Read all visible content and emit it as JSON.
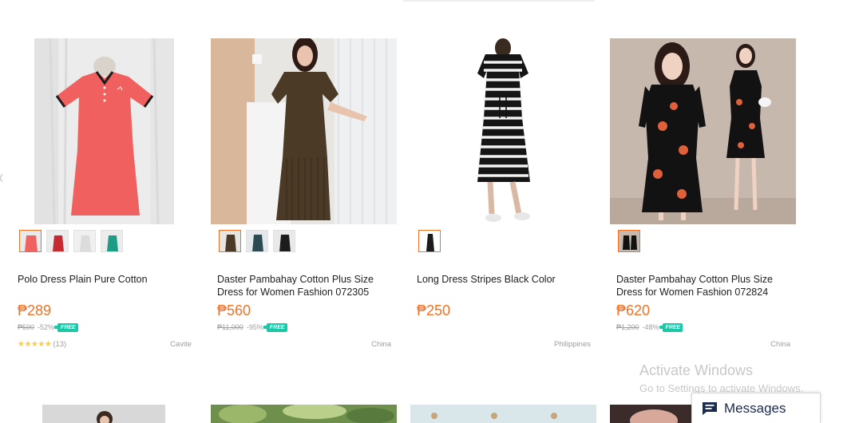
{
  "products": [
    {
      "title": "Polo Dress Plain Pure Cotton",
      "price": "₱289",
      "original_price": "₱590",
      "discount": "-52%",
      "free_shipping_label": "FREE",
      "rating_stars": "★★★★★",
      "rating_value": 4.5,
      "review_count": "(13)",
      "location": "Cavite"
    },
    {
      "title": "Daster Pambahay Cotton Plus Size Dress for Women Fashion 072305",
      "price": "₱560",
      "original_price": "₱11,000",
      "discount": "-95%",
      "free_shipping_label": "FREE",
      "location": "China"
    },
    {
      "title": "Long Dress Stripes Black Color",
      "price": "₱250",
      "location": "Philippines"
    },
    {
      "title": "Daster Pambahay Cotton Plus Size Dress for Women Fashion 072824",
      "price": "₱620",
      "original_price": "₱1,200",
      "discount": "-48%",
      "free_shipping_label": "FREE",
      "location": "China"
    }
  ],
  "watermark": {
    "line1": "Activate Windows",
    "line2": "Go to Settings to activate Windows."
  },
  "messages": {
    "label": "Messages",
    "icon": "chat-icon"
  },
  "colors": {
    "price": "#f57224",
    "free_badge": "#1bc8a6",
    "star": "#faca51",
    "selected_thumb_border": "#f57224"
  }
}
